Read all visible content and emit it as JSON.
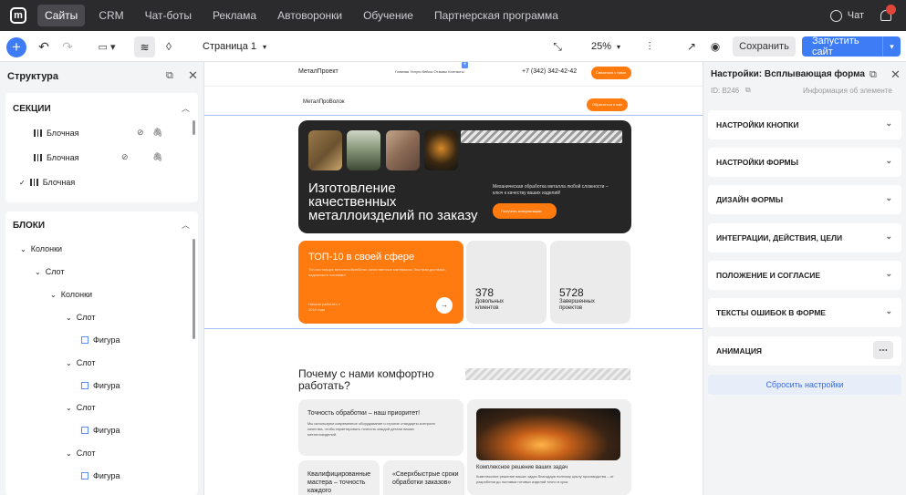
{
  "topnav": {
    "items": [
      "Сайты",
      "CRM",
      "Чат-боты",
      "Реклама",
      "Автоворонки",
      "Обучение",
      "Партнерская программа"
    ],
    "chat": "Чат"
  },
  "toolbar": {
    "page": "Страница 1",
    "zoom": "25%",
    "save": "Сохранить",
    "run": "Запустить сайт"
  },
  "left": {
    "title": "Структура",
    "sections_title": "СЕКЦИИ",
    "sections": [
      "Блочная",
      "Блочная",
      "Блочная"
    ],
    "blocks_title": "БЛОКИ",
    "tree": [
      "Колонки",
      "Слот",
      "Колонки",
      "Слот",
      "Фигура",
      "Слот",
      "Фигура",
      "Слот",
      "Фигура",
      "Слот",
      "Фигура"
    ]
  },
  "site": {
    "header1_logo": "МеталПроект",
    "menu": "Главная   Услуги   Кейсы   Отзывы   Контакты",
    "phone": "+7 (342) 342-42-42",
    "header_btn": "Связаться с нами",
    "header2_logo": "МеталПроВолок",
    "header2_btn": "Обратиться к нам",
    "hero_title": "Изготовление качественных металлоизделий по заказу",
    "hero_text": "Механическая обработка металла любой сложности – ключ к качеству ваших изделий!",
    "hero_btn": "Получить консультацию",
    "top_title": "ТОП-10 в своей сфере",
    "top_text": "Топ-поставщик металлообработки: качественные материалы, быстрая доставка, надежность поставки!",
    "top_small": "Начали работать с 2010 года",
    "arrow": "→",
    "stat1_num": "378",
    "stat1_label": "Довольных клиентов",
    "stat2_num": "5728",
    "stat2_label": "Завершенных проектов",
    "why_title": "Почему с нами комфортно работать?",
    "card1_title": "Точность обработки – наш приоритет!",
    "card1_text": "Мы используем современное оборудование и строгие стандарты контроля качества, чтобы гарантировать точность каждой детали ваших металлоизделий.",
    "card2_title": "Комплексное решение ваших задач",
    "card2_text": "Комплексное решение ваших задач благодаря полному циклу производства – от разработки до поставки готовых изделий точно в срок.",
    "card3_title": "Квалифицированные мастера – точность каждого",
    "card4_title": "«Сверхбыстрые сроки обработки заказов»"
  },
  "right": {
    "title": "Настройки: Всплывающая форма",
    "id": "ID: B246",
    "info": "Информация об элементе",
    "sections": [
      "НАСТРОЙКИ КНОПКИ",
      "НАСТРОЙКИ ФОРМЫ",
      "ДИЗАЙН ФОРМЫ",
      "ИНТЕГРАЦИИ, ДЕЙСТВИЯ, ЦЕЛИ",
      "ПОЛОЖЕНИЕ И СОГЛАСИЕ",
      "ТЕКСТЫ ОШИБОК В ФОРМЕ",
      "АНИМАЦИЯ"
    ],
    "reset": "Сбросить настройки"
  },
  "colors": {
    "accent": "#3d7cf5",
    "orange": "#ff7a0f",
    "dark": "#2b2b2e"
  }
}
